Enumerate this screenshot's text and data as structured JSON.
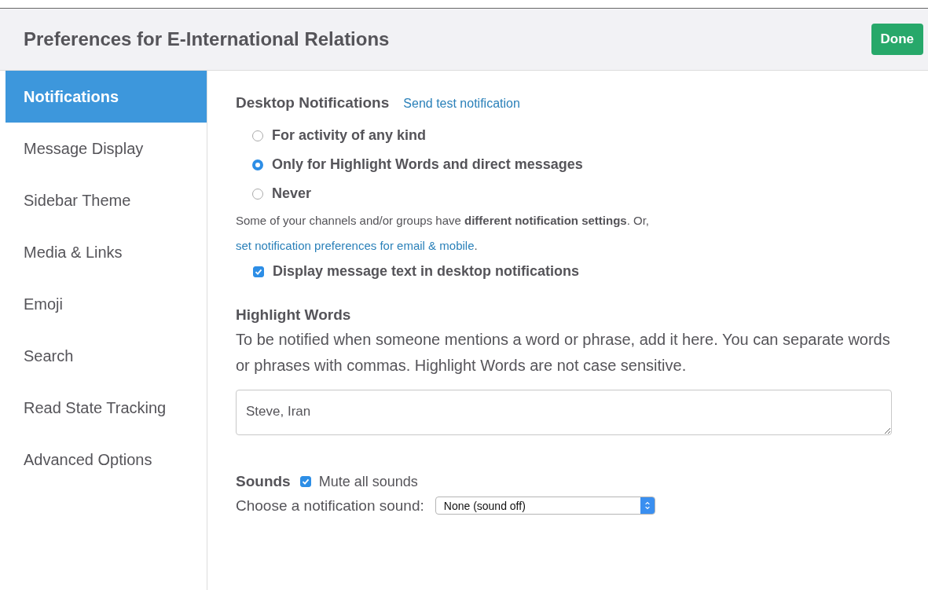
{
  "header": {
    "title": "Preferences for E-International Relations",
    "done_button": "Done"
  },
  "sidebar": {
    "items": [
      {
        "label": "Notifications",
        "selected": true
      },
      {
        "label": "Message Display",
        "selected": false
      },
      {
        "label": "Sidebar Theme",
        "selected": false
      },
      {
        "label": "Media & Links",
        "selected": false
      },
      {
        "label": "Emoji",
        "selected": false
      },
      {
        "label": "Search",
        "selected": false
      },
      {
        "label": "Read State Tracking",
        "selected": false
      },
      {
        "label": "Advanced Options",
        "selected": false
      }
    ]
  },
  "desktop_notifications": {
    "heading": "Desktop Notifications",
    "test_link": "Send test notification",
    "options": [
      {
        "label": "For activity of any kind",
        "selected": false
      },
      {
        "label": "Only for Highlight Words and direct messages",
        "selected": true
      },
      {
        "label": "Never",
        "selected": false
      }
    ],
    "note": {
      "text": "Some of your channels and/or groups have **different notification settings**. Or, ",
      "link": "set notification preferences for email & mobile",
      "end": "."
    },
    "display_text": {
      "label": "Display message text in desktop notifications",
      "checked": true
    }
  },
  "highlight_words": {
    "heading": "Highlight Words",
    "description": "To be notified when someone mentions a word or phrase, add it here. You can separate words or phrases with commas. Highlight Words are not case sensitive.",
    "value": "Steve, Iran"
  },
  "sounds": {
    "heading": "Sounds",
    "mute": {
      "label": "Mute all sounds",
      "checked": true
    },
    "sound_label": "Choose a notification sound:",
    "sound_value": "None (sound off)"
  }
}
